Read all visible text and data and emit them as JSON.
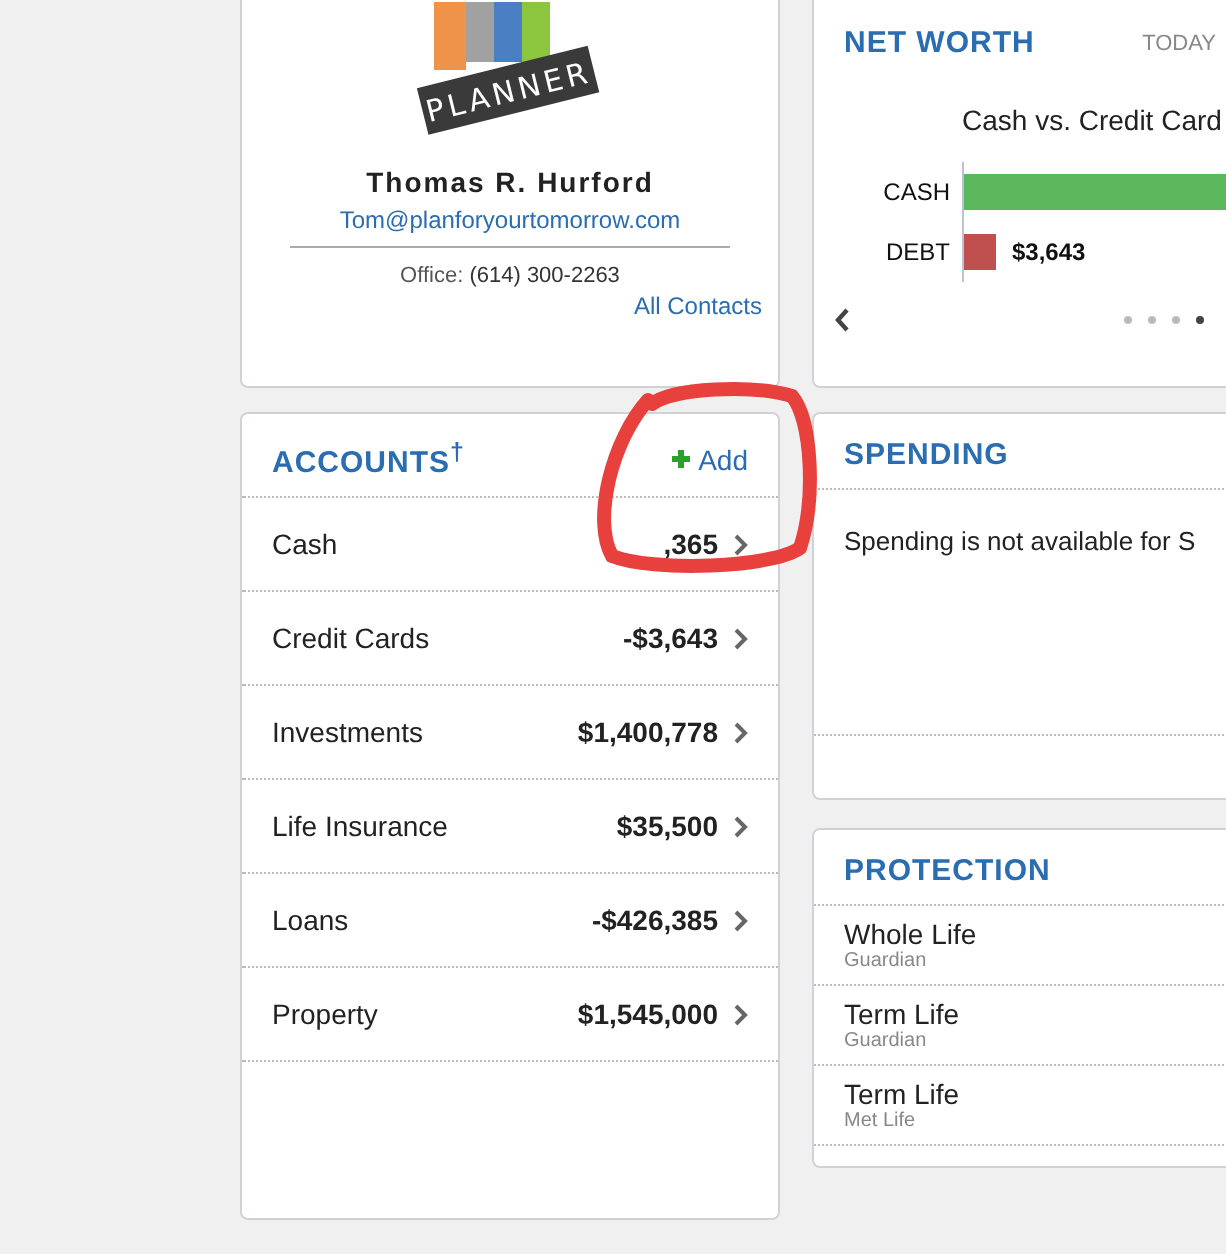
{
  "contact": {
    "logo_word": "PLANNER",
    "name": "Thomas R. Hurford",
    "email": "Tom@planforyourtomorrow.com",
    "office_label": "Office:",
    "office_phone": "(614) 300-2263",
    "all_contacts": "All Contacts"
  },
  "accounts": {
    "title": "ACCOUNTS",
    "title_mark": "†",
    "add": "Add",
    "rows": [
      {
        "name": "Cash",
        "value": ",365"
      },
      {
        "name": "Credit Cards",
        "value": "-$3,643"
      },
      {
        "name": "Investments",
        "value": "$1,400,778"
      },
      {
        "name": "Life Insurance",
        "value": "$35,500"
      },
      {
        "name": "Loans",
        "value": "-$426,385"
      },
      {
        "name": "Property",
        "value": "$1,545,000"
      }
    ]
  },
  "net_worth": {
    "title": "NET WORTH",
    "period": "TODAY",
    "chart_title": "Cash vs. Credit Card",
    "bars": [
      {
        "label": "CASH",
        "color": "#5cb85c",
        "kind": "long"
      },
      {
        "label": "DEBT",
        "color": "#c0504d",
        "kind": "short",
        "value_label": "$3,643"
      }
    ],
    "pages": [
      {
        "selected": false
      },
      {
        "selected": false
      },
      {
        "selected": false
      },
      {
        "selected": true
      }
    ]
  },
  "spending": {
    "title": "SPENDING",
    "message": "Spending is not available for S"
  },
  "protection": {
    "title": "PROTECTION",
    "items": [
      {
        "name": "Whole Life",
        "carrier": "Guardian"
      },
      {
        "name": "Term Life",
        "carrier": "Guardian"
      },
      {
        "name": "Term Life",
        "carrier": "Met Life"
      }
    ]
  }
}
